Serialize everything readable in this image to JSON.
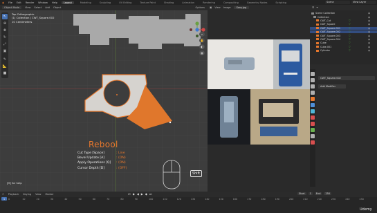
{
  "menu": [
    "File",
    "Edit",
    "Render",
    "Window",
    "Help"
  ],
  "workspaces": [
    "Layout",
    "Modeling",
    "Sculpting",
    "UV Editing",
    "Texture Paint",
    "Shading",
    "Animation",
    "Rendering",
    "Compositing",
    "Geometry Nodes",
    "Scripting"
  ],
  "active_workspace": "Layout",
  "scene": "Scene",
  "view_layer": "View Layer",
  "viewport": {
    "mode": "Object Mode",
    "menus": [
      "View",
      "Select",
      "Add",
      "Object"
    ],
    "shading_label": "Options",
    "info_lines": [
      "Top Orthographic",
      "(1) Collection | CWT_Square.002",
      "10 Centimeters"
    ],
    "help_text": "[H] for help"
  },
  "rebool": {
    "title": "Rebool",
    "rows": [
      {
        "label": "Cut Type [Space]",
        "value": ": Line"
      },
      {
        "label": "Bevel Update [A]",
        "value": ": (ON)"
      },
      {
        "label": "Apply Operations [Q]",
        "value": ": (ON)"
      },
      {
        "label": "Cursor Depth [D]",
        "value": ": (OFF)"
      }
    ]
  },
  "shift_key": "Shift",
  "image_editor": {
    "menus": [
      "View",
      "Image"
    ],
    "file": "Sony.jpg"
  },
  "outliner": {
    "header": "Scene Collection",
    "items": [
      {
        "name": "Scene Collection",
        "color": "#8a8a8a",
        "selected": false
      },
      {
        "name": "Collection",
        "color": "#8a8a8a",
        "selected": false
      },
      {
        "name": "CWT_Cut",
        "color": "#e8782d",
        "selected": false
      },
      {
        "name": "CWT_Square",
        "color": "#e8782d",
        "selected": false
      },
      {
        "name": "CWT_Square.001",
        "color": "#e8782d",
        "selected": true
      },
      {
        "name": "CWT_Square.002",
        "color": "#e8782d",
        "selected": true
      },
      {
        "name": "CWT_Square.003",
        "color": "#e8782d",
        "selected": false
      },
      {
        "name": "CWT_Square.004",
        "color": "#e8782d",
        "selected": false
      },
      {
        "name": "Cube",
        "color": "#e8782d",
        "selected": false
      },
      {
        "name": "Cube.001",
        "color": "#e8782d",
        "selected": false
      },
      {
        "name": "Cylinder",
        "color": "#e8782d",
        "selected": false
      }
    ]
  },
  "properties": {
    "object_name": "CWT_Square.002",
    "add_modifier": "Add Modifier"
  },
  "timeline": {
    "menus": [
      "Playback",
      "Keying",
      "View",
      "Marker"
    ],
    "frame_labels": [
      "Start",
      "1",
      "End",
      "250"
    ],
    "ticks": [
      "0",
      "10",
      "20",
      "30",
      "40",
      "50",
      "60",
      "70",
      "80",
      "90",
      "100",
      "110",
      "120",
      "130",
      "140",
      "150",
      "160",
      "170",
      "180",
      "190",
      "200",
      "210",
      "220",
      "230",
      "240",
      "250"
    ],
    "current_frame": "1"
  },
  "watermark": "Udemy"
}
